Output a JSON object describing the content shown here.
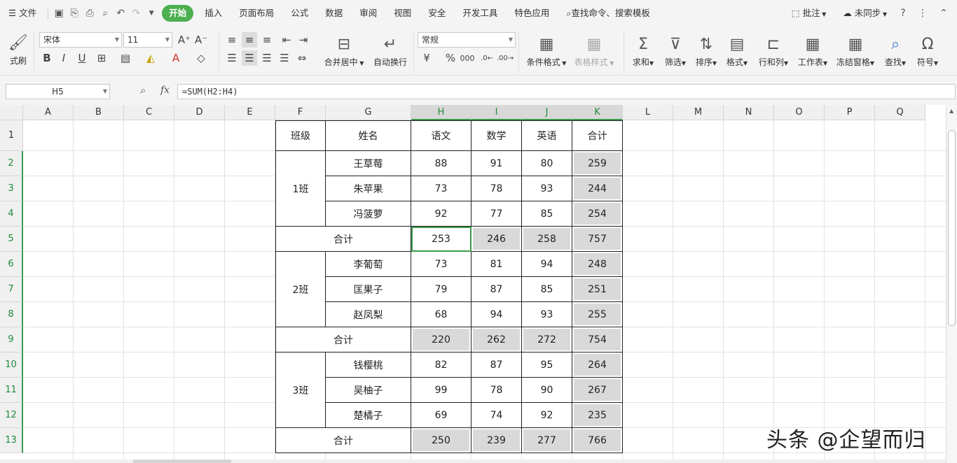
{
  "menu": {
    "file": "文件",
    "tabs": [
      "开始",
      "插入",
      "页面布局",
      "公式",
      "数据",
      "审阅",
      "视图",
      "安全",
      "开发工具",
      "特色应用"
    ],
    "search": "查找命令、搜索模板",
    "comment": "批注",
    "sync": "未同步"
  },
  "ribbon": {
    "format_painter": "式刷",
    "font_name": "宋体",
    "font_size": "11",
    "number_format": "常规",
    "merge_center": "合并居中",
    "wrap_text": "自动换行",
    "conditional_format": "条件格式",
    "table_style": "表格样式",
    "sum": "求和",
    "filter": "筛选",
    "sort": "排序",
    "format": "格式",
    "rows_cols": "行和列",
    "worksheet": "工作表",
    "freeze": "冻结窗格",
    "find": "查找",
    "symbol": "符号"
  },
  "formula_bar": {
    "name_box": "H5",
    "fx": "fx",
    "formula": "=SUM(H2:H4)"
  },
  "columns": [
    "A",
    "B",
    "C",
    "D",
    "E",
    "F",
    "G",
    "H",
    "I",
    "J",
    "K",
    "L",
    "M",
    "N",
    "O",
    "P",
    "Q"
  ],
  "rows": [
    "1",
    "2",
    "3",
    "4",
    "5",
    "6",
    "7",
    "8",
    "9",
    "10",
    "11",
    "12",
    "13"
  ],
  "table": {
    "headers": {
      "class": "班级",
      "name": "姓名",
      "chinese": "语文",
      "math": "数学",
      "english": "英语",
      "total": "合计"
    },
    "groups": [
      {
        "class": "1班",
        "students": [
          {
            "name": "王草莓",
            "chinese": "88",
            "math": "91",
            "english": "80",
            "total": "259"
          },
          {
            "name": "朱苹果",
            "chinese": "73",
            "math": "78",
            "english": "93",
            "total": "244"
          },
          {
            "name": "冯菠萝",
            "chinese": "92",
            "math": "77",
            "english": "85",
            "total": "254"
          }
        ],
        "subtotal": {
          "label": "合计",
          "chinese": "253",
          "math": "246",
          "english": "258",
          "total": "757"
        }
      },
      {
        "class": "2班",
        "students": [
          {
            "name": "李葡萄",
            "chinese": "73",
            "math": "81",
            "english": "94",
            "total": "248"
          },
          {
            "name": "匡果子",
            "chinese": "79",
            "math": "87",
            "english": "85",
            "total": "251"
          },
          {
            "name": "赵凤梨",
            "chinese": "68",
            "math": "94",
            "english": "93",
            "total": "255"
          }
        ],
        "subtotal": {
          "label": "合计",
          "chinese": "220",
          "math": "262",
          "english": "272",
          "total": "754"
        }
      },
      {
        "class": "3班",
        "students": [
          {
            "name": "钱樱桃",
            "chinese": "82",
            "math": "87",
            "english": "95",
            "total": "264"
          },
          {
            "name": "吴柚子",
            "chinese": "99",
            "math": "78",
            "english": "90",
            "total": "267"
          },
          {
            "name": "楚橘子",
            "chinese": "69",
            "math": "74",
            "english": "92",
            "total": "235"
          }
        ],
        "subtotal": {
          "label": "合计",
          "chinese": "250",
          "math": "239",
          "english": "277",
          "total": "766"
        }
      }
    ]
  },
  "watermark": "头条 @企望而归",
  "colors": {
    "accent": "#4caf50",
    "selection": "#3c9a4c",
    "highlight_fill": "#d9d9d9"
  }
}
